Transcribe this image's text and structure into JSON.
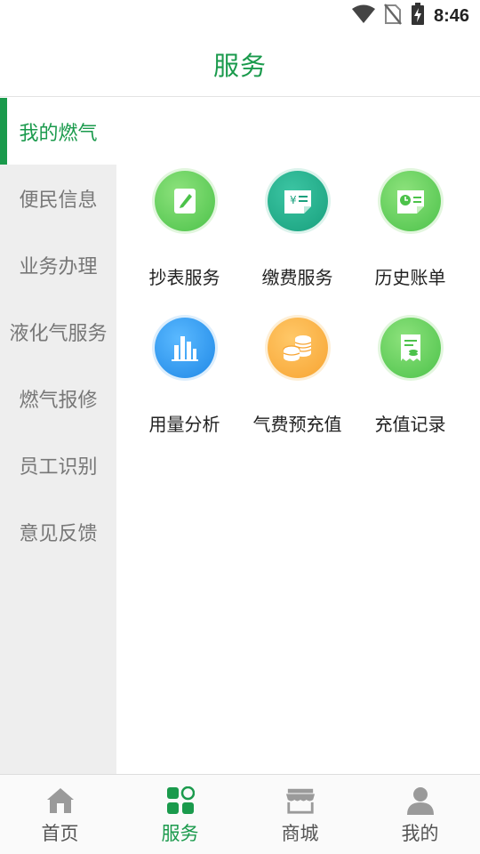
{
  "status_bar": {
    "time": "8:46",
    "icons": [
      "wifi-icon",
      "no-sim-icon",
      "battery-charging-icon"
    ]
  },
  "header": {
    "title": "服务"
  },
  "sidebar": {
    "items": [
      {
        "label": "我的燃气",
        "active": true
      },
      {
        "label": "便民信息"
      },
      {
        "label": "业务办理"
      },
      {
        "label": "液化气服务"
      },
      {
        "label": "燃气报修"
      },
      {
        "label": "员工识别"
      },
      {
        "label": "意见反馈"
      }
    ]
  },
  "services": [
    {
      "label": "抄表服务",
      "icon": "edit-note-icon",
      "color": "#5bcb52"
    },
    {
      "label": "缴费服务",
      "icon": "payment-yen-icon",
      "color": "#1fae88"
    },
    {
      "label": "历史账单",
      "icon": "history-bill-icon",
      "color": "#5bcb52"
    },
    {
      "label": "用量分析",
      "icon": "bar-chart-icon",
      "color": "#2c95ef"
    },
    {
      "label": "气费预充值",
      "icon": "coins-icon",
      "color": "#f9ad3c"
    },
    {
      "label": "充值记录",
      "icon": "recharge-record-icon",
      "color": "#5bcb52"
    }
  ],
  "tabbar": {
    "tabs": [
      {
        "label": "首页",
        "icon": "home-icon"
      },
      {
        "label": "服务",
        "icon": "services-grid-icon",
        "active": true
      },
      {
        "label": "商城",
        "icon": "store-icon"
      },
      {
        "label": "我的",
        "icon": "user-icon"
      }
    ]
  },
  "colors": {
    "accent": "#1a9a4c",
    "sidebar_bg": "#eeeeee",
    "inactive_text": "#777777"
  }
}
